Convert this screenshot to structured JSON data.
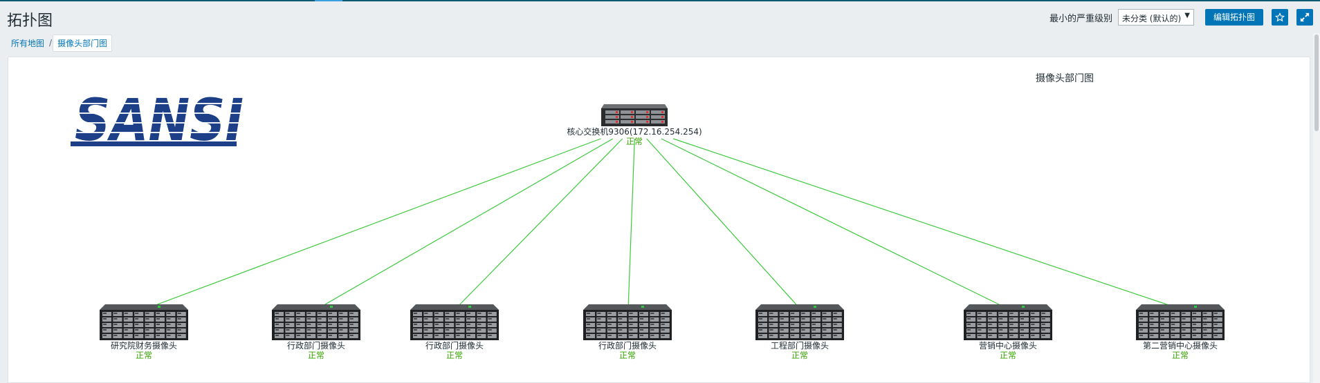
{
  "header": {
    "title": "拓扑图",
    "severity_label": "最小的严重级别",
    "severity_value": "未分类 (默认的)",
    "edit_button": "编辑拓扑图"
  },
  "breadcrumb": {
    "root": "所有地图",
    "separator": "/",
    "current": "摄像头部门图"
  },
  "map": {
    "title": "摄像头部门图",
    "logo_text": "SANSI",
    "link_color": "#3cc93c",
    "core": {
      "label": "核心交换机9306(172.16.254.254)",
      "status": "正常"
    },
    "nodes": [
      {
        "label": "研究院财务摄像头",
        "status": "正常"
      },
      {
        "label": "行政部门摄像头",
        "status": "正常"
      },
      {
        "label": "行政部门摄像头",
        "status": "正常"
      },
      {
        "label": "行政部门摄像头",
        "status": "正常"
      },
      {
        "label": "工程部门摄像头",
        "status": "正常"
      },
      {
        "label": "营销中心摄像头",
        "status": "正常"
      },
      {
        "label": "第二营销中心摄像头",
        "status": "正常"
      }
    ]
  },
  "colors": {
    "accent": "#0275b8",
    "status_ok": "#34a100",
    "logo_blue": "#1c3f87"
  },
  "icons": {
    "star": "star-icon",
    "fullscreen": "fullscreen-icon",
    "caret": "▼"
  }
}
